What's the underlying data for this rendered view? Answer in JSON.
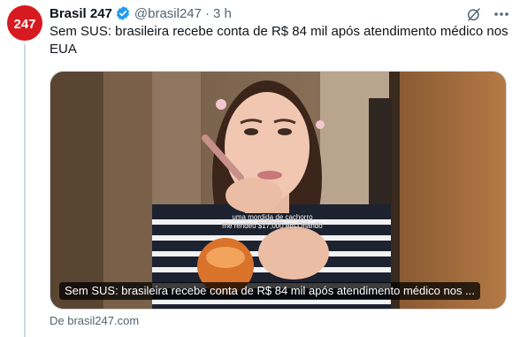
{
  "tweet": {
    "author_name": "Brasil 247",
    "handle": "@brasil247",
    "separator": "·",
    "time": "3 h",
    "text": "Sem SUS: brasileira recebe conta de R$ 84 mil após atendimento médico nos EUA",
    "avatar_text": "247"
  },
  "card": {
    "caption": "Sem SUS: brasileira recebe conta de R$ 84 mil após atendimento médico nos ...",
    "overlay_line1": "uma mordida de cachorro",
    "overlay_line2": "me rendeu $17,000 em Orlando",
    "source": "De brasil247.com"
  },
  "colors": {
    "avatar_red": "#d71920",
    "verified_blue": "#1d9bf0",
    "muted_text": "#536471"
  },
  "icons": {
    "verified": "verified-badge-icon",
    "grok": "grok-icon",
    "more": "more-options-icon"
  }
}
